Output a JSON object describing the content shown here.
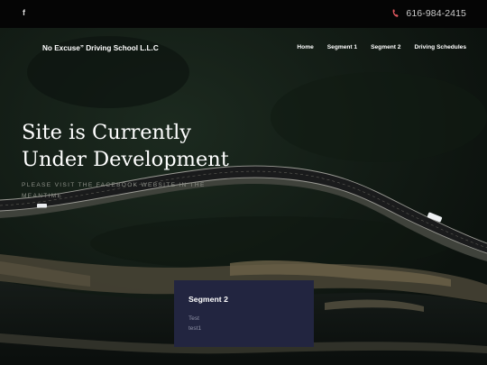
{
  "topbar": {
    "social_icon": "facebook-icon",
    "social_glyph": "f",
    "phone_icon": "phone-icon",
    "phone": "616-984-2415",
    "phone_icon_color": "#e0585f"
  },
  "header": {
    "brand": "No Excuse” Driving School L.L.C",
    "nav": [
      {
        "label": "Home"
      },
      {
        "label": "Segment 1"
      },
      {
        "label": "Segment 2"
      },
      {
        "label": "Driving Schedules"
      }
    ]
  },
  "hero": {
    "title_line1": "Site is Currently",
    "title_line2": "Under Development",
    "subtitle": "Please visit the Facebook Website in the meantime"
  },
  "card": {
    "title": "Segment 2",
    "line1": "Test",
    "line2": "test1",
    "background": "#222540"
  }
}
